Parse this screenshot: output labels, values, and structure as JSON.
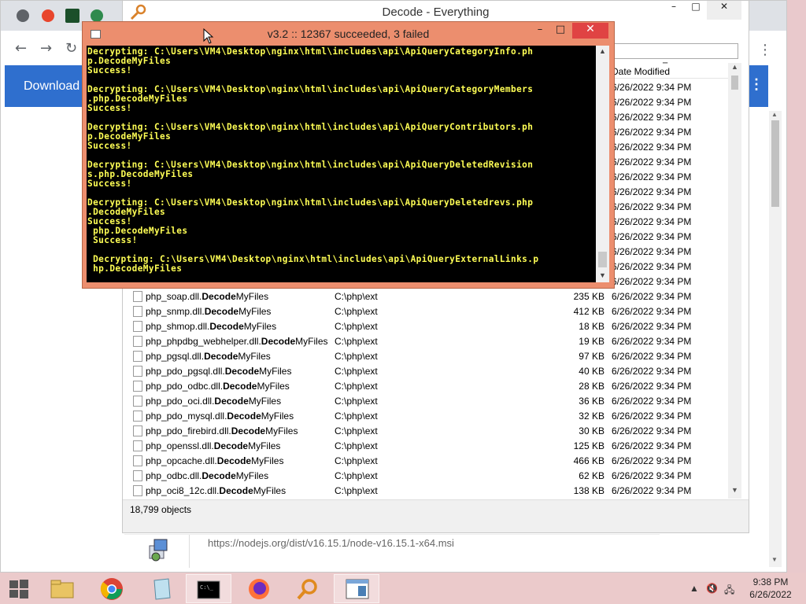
{
  "browser": {
    "download_label": "Download",
    "download_right_icon": "⋮",
    "menu_icon": "⋮",
    "download_url": "https://nodejs.org/dist/v16.15.1/node-v16.15.1-x64.msi"
  },
  "everything": {
    "title": "Decode - Everything",
    "date_modified_header": "Date Modified",
    "status_objects": "18,799 objects",
    "background_dates": [
      "6/26/2022 9:34 PM",
      "6/26/2022 9:34 PM",
      "6/26/2022 9:34 PM",
      "6/26/2022 9:34 PM",
      "6/26/2022 9:34 PM",
      "6/26/2022 9:34 PM",
      "6/26/2022 9:34 PM",
      "6/26/2022 9:34 PM",
      "6/26/2022 9:34 PM",
      "6/26/2022 9:34 PM",
      "6/26/2022 9:34 PM",
      "6/26/2022 9:34 PM",
      "6/26/2022 9:34 PM",
      "6/26/2022 9:34 PM"
    ],
    "rows": [
      {
        "pre": "php_soap.dll.",
        "bold": "Decode",
        "post": "MyFiles",
        "path": "C:\\php\\ext",
        "size": "235 KB",
        "date": "6/26/2022 9:34 PM"
      },
      {
        "pre": "php_snmp.dll.",
        "bold": "Decode",
        "post": "MyFiles",
        "path": "C:\\php\\ext",
        "size": "412 KB",
        "date": "6/26/2022 9:34 PM"
      },
      {
        "pre": "php_shmop.dll.",
        "bold": "Decode",
        "post": "MyFiles",
        "path": "C:\\php\\ext",
        "size": "18 KB",
        "date": "6/26/2022 9:34 PM"
      },
      {
        "pre": "php_phpdbg_webhelper.dll.",
        "bold": "Decode",
        "post": "MyFiles",
        "path": "C:\\php\\ext",
        "size": "19 KB",
        "date": "6/26/2022 9:34 PM"
      },
      {
        "pre": "php_pgsql.dll.",
        "bold": "Decode",
        "post": "MyFiles",
        "path": "C:\\php\\ext",
        "size": "97 KB",
        "date": "6/26/2022 9:34 PM"
      },
      {
        "pre": "php_pdo_pgsql.dll.",
        "bold": "Decode",
        "post": "MyFiles",
        "path": "C:\\php\\ext",
        "size": "40 KB",
        "date": "6/26/2022 9:34 PM"
      },
      {
        "pre": "php_pdo_odbc.dll.",
        "bold": "Decode",
        "post": "MyFiles",
        "path": "C:\\php\\ext",
        "size": "28 KB",
        "date": "6/26/2022 9:34 PM"
      },
      {
        "pre": "php_pdo_oci.dll.",
        "bold": "Decode",
        "post": "MyFiles",
        "path": "C:\\php\\ext",
        "size": "36 KB",
        "date": "6/26/2022 9:34 PM"
      },
      {
        "pre": "php_pdo_mysql.dll.",
        "bold": "Decode",
        "post": "MyFiles",
        "path": "C:\\php\\ext",
        "size": "32 KB",
        "date": "6/26/2022 9:34 PM"
      },
      {
        "pre": "php_pdo_firebird.dll.",
        "bold": "Decode",
        "post": "MyFiles",
        "path": "C:\\php\\ext",
        "size": "30 KB",
        "date": "6/26/2022 9:34 PM"
      },
      {
        "pre": "php_openssl.dll.",
        "bold": "Decode",
        "post": "MyFiles",
        "path": "C:\\php\\ext",
        "size": "125 KB",
        "date": "6/26/2022 9:34 PM"
      },
      {
        "pre": "php_opcache.dll.",
        "bold": "Decode",
        "post": "MyFiles",
        "path": "C:\\php\\ext",
        "size": "466 KB",
        "date": "6/26/2022 9:34 PM"
      },
      {
        "pre": "php_odbc.dll.",
        "bold": "Decode",
        "post": "MyFiles",
        "path": "C:\\php\\ext",
        "size": "62 KB",
        "date": "6/26/2022 9:34 PM"
      },
      {
        "pre": "php_oci8_12c.dll.",
        "bold": "Decode",
        "post": "MyFiles",
        "path": "C:\\php\\ext",
        "size": "138 KB",
        "date": "6/26/2022 9:34 PM"
      }
    ]
  },
  "console": {
    "title": "v3.2 :: 12367 succeeded, 3 failed",
    "output": "Decrypting: C:\\Users\\VM4\\Desktop\\nginx\\html\\includes\\api\\ApiQueryCategoryInfo.ph\np.DecodeMyFiles\nSuccess!\n\nDecrypting: C:\\Users\\VM4\\Desktop\\nginx\\html\\includes\\api\\ApiQueryCategoryMembers\n.php.DecodeMyFiles\nSuccess!\n\nDecrypting: C:\\Users\\VM4\\Desktop\\nginx\\html\\includes\\api\\ApiQueryContributors.ph\np.DecodeMyFiles\nSuccess!\n\nDecrypting: C:\\Users\\VM4\\Desktop\\nginx\\html\\includes\\api\\ApiQueryDeletedRevision\ns.php.DecodeMyFiles\nSuccess!\n\nDecrypting: C:\\Users\\VM4\\Desktop\\nginx\\html\\includes\\api\\ApiQueryDeletedrevs.php\n.DecodeMyFiles\nSuccess!\n php.DecodeMyFiles\n Success!\n\n Decrypting: C:\\Users\\VM4\\Desktop\\nginx\\html\\includes\\api\\ApiQueryExternalLinks.p\n hp.DecodeMyFiles"
  },
  "taskbar": {
    "time": "9:38 PM",
    "date": "6/26/2022"
  },
  "colors": {
    "console_frame": "#ec8e6e",
    "console_text": "#ffff55",
    "download_bar": "#2f6fce",
    "close_red": "#e04343"
  }
}
